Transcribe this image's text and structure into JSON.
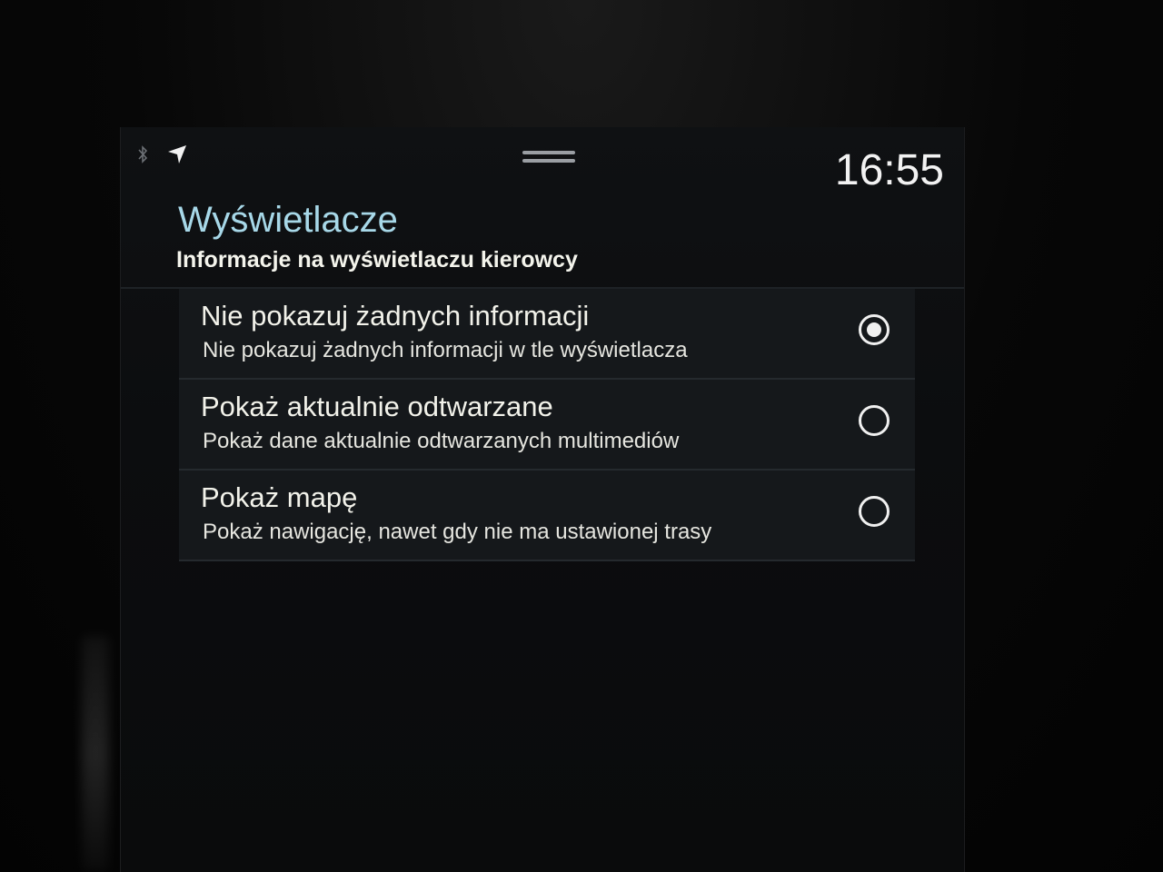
{
  "status_bar": {
    "bluetooth_icon": "bluetooth-icon",
    "navigation_icon": "navigation-arrow-icon",
    "time": "16:55"
  },
  "header": {
    "title": "Wyświetlacze",
    "subtitle": "Informacje na wyświetlaczu kierowcy"
  },
  "options": [
    {
      "label": "Nie pokazuj żadnych informacji",
      "description": "Nie pokazuj żadnych informacji w tle wyświetlacza",
      "selected": true
    },
    {
      "label": "Pokaż aktualnie odtwarzane",
      "description": "Pokaż dane aktualnie odtwarzanych multimediów",
      "selected": false
    },
    {
      "label": "Pokaż mapę",
      "description": "Pokaż nawigację, nawet gdy nie ma ustawionej trasy",
      "selected": false
    }
  ],
  "colors": {
    "title_accent": "#a7d8e8",
    "text_primary": "#f2f2ea",
    "background": "#0c0d0f"
  }
}
